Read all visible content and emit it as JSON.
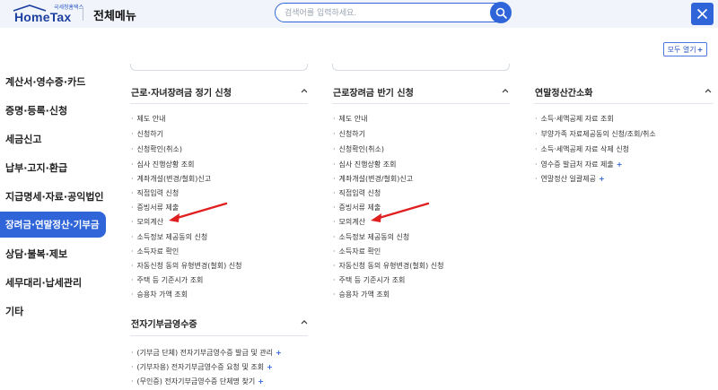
{
  "header": {
    "logo_small": "국세청홈택스",
    "logo_big": "HomeTax",
    "title": "전체메뉴",
    "search_placeholder": "검색어를 입력하세요."
  },
  "expand_all": {
    "label": "모두 열기",
    "plus": "+"
  },
  "sidebar": {
    "items": [
      {
        "label": "계산서·영수증·카드"
      },
      {
        "label": "증명·등록·신청"
      },
      {
        "label": "세금신고"
      },
      {
        "label": "납부·고지·환급"
      },
      {
        "label": "지급명세·자료·공익법인"
      },
      {
        "label": "장려금·연말정산·기부금",
        "active": true
      },
      {
        "label": "상담·불복·제보"
      },
      {
        "label": "세무대리·납세관리"
      },
      {
        "label": "기타"
      }
    ]
  },
  "sections": {
    "regular": {
      "title": "근로·자녀장려금 정기 신청",
      "items": [
        "제도 안내",
        "신청하기",
        "신청확인(취소)",
        "심사 진행상황 조회",
        "계좌개설(변경/철회)신고",
        "직접입력 신청",
        "증빙서류 제출",
        "모의계산",
        "소득정보 제공동의 신청",
        "소득자료 확인",
        "자동신청 동의 유형변경(철회) 신청",
        "주택 등 기준시가 조회",
        "승용차 가액 조회"
      ]
    },
    "half": {
      "title": "근로장려금 반기 신청",
      "items": [
        "제도 안내",
        "신청하기",
        "신청확인(취소)",
        "심사 진행상황 조회",
        "계좌개설(변경/철회)신고",
        "직접입력 신청",
        "증빙서류 제출",
        "모의계산",
        "소득정보 제공동의 신청",
        "소득자료 확인",
        "자동신청 동의 유형변경(철회) 신청",
        "주택 등 기준시가 조회",
        "승용차 가액 조회"
      ]
    },
    "yearend": {
      "title": "연말정산간소화",
      "items": [
        {
          "label": "소득·세액공제 자료 조회",
          "plus": ""
        },
        {
          "label": "부양가족 자료제공동의 신청/조회/취소",
          "plus": ""
        },
        {
          "label": "소득·세액공제 자료 삭제 신청",
          "plus": ""
        },
        {
          "label": "영수증 발급처 자료 제출",
          "plus": "+"
        },
        {
          "label": "연말정산 일괄제공",
          "plus": "+"
        }
      ]
    },
    "donation": {
      "title": "전자기부금영수증",
      "items": [
        {
          "label": "(기부금 단체) 전자기부금영수증 발급 및 관리",
          "plus": "+"
        },
        {
          "label": "(기부자용) 전자기부금영수증 요청 및 조회",
          "plus": "+"
        },
        {
          "label": "(무인증) 전자기부금영수증 단체명 찾기",
          "plus": "+"
        }
      ]
    }
  },
  "bullet": "·",
  "colors": {
    "accent": "#2f65d8",
    "arrow": "#e02020"
  },
  "icons": {
    "search": "search-icon",
    "close": "close-icon",
    "chevron": "chevron-up-icon",
    "arrow": "red-arrow-annotation"
  }
}
